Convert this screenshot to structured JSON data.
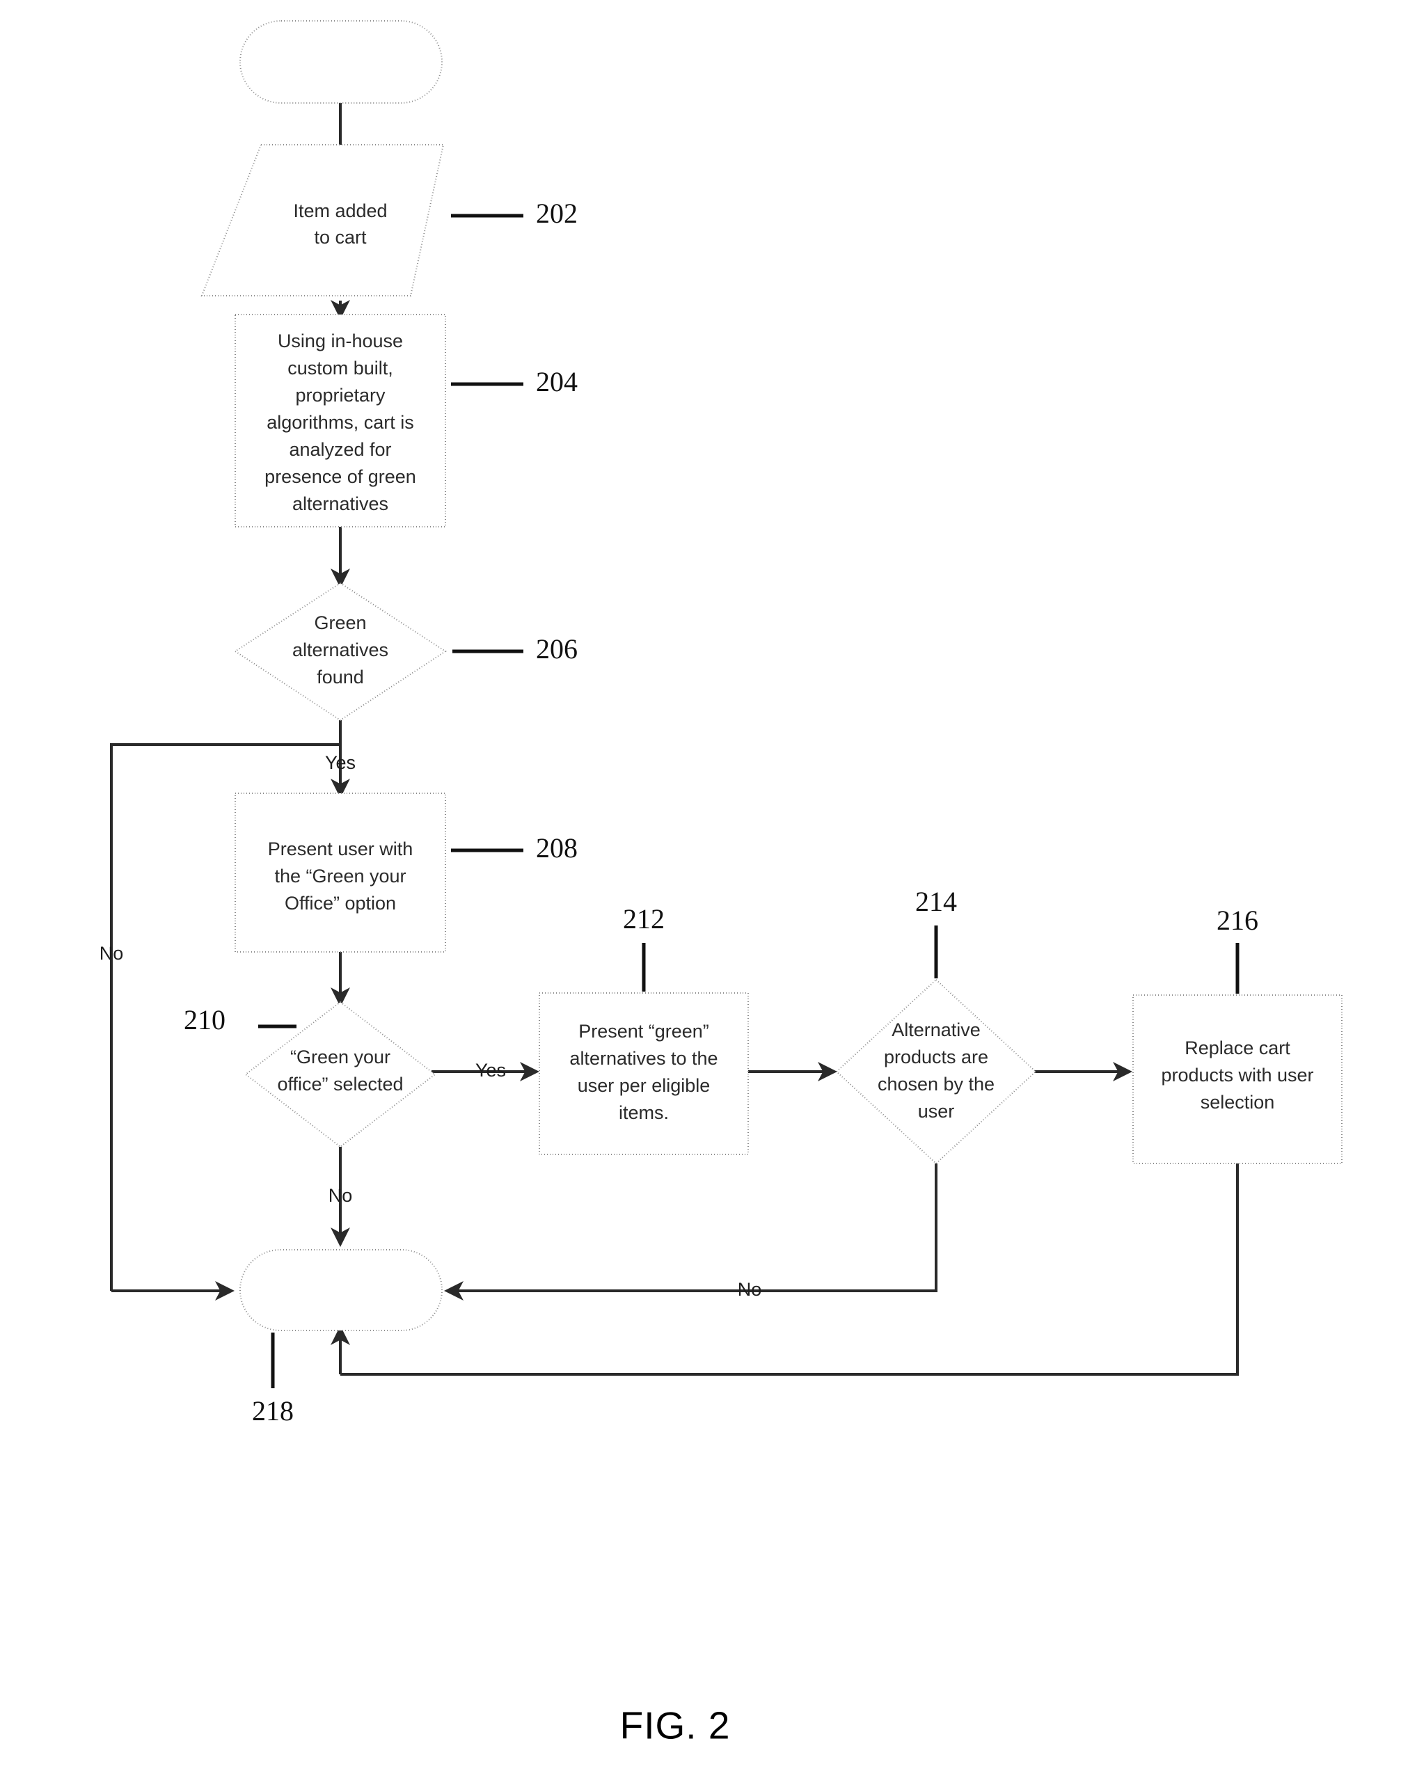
{
  "figure": {
    "caption": "FIG. 2",
    "title": "Green alternatives shopping cart flowchart"
  },
  "nodes": [
    {
      "id": "start",
      "shape": "terminator",
      "ref": "",
      "lines": []
    },
    {
      "id": "n202",
      "shape": "parallelogram",
      "ref": "202",
      "lines": [
        "Item added",
        "to cart"
      ]
    },
    {
      "id": "n204",
      "shape": "process",
      "ref": "204",
      "lines": [
        "Using in-house",
        "custom built,",
        "proprietary",
        "algorithms, cart is",
        "analyzed for",
        "presence of green",
        "alternatives"
      ]
    },
    {
      "id": "n206",
      "shape": "decision",
      "ref": "206",
      "lines": [
        "Green",
        "alternatives",
        "found"
      ]
    },
    {
      "id": "n208",
      "shape": "process",
      "ref": "208",
      "lines": [
        "Present user with",
        "the “Green your",
        "Office” option"
      ]
    },
    {
      "id": "n210",
      "shape": "decision",
      "ref": "210",
      "lines": [
        "“Green your",
        "office” selected"
      ]
    },
    {
      "id": "n212",
      "shape": "process",
      "ref": "212",
      "lines": [
        "Present “green”",
        "alternatives to the",
        "user per eligible",
        "items."
      ]
    },
    {
      "id": "n214",
      "shape": "decision",
      "ref": "214",
      "lines": [
        "Alternative",
        "products are",
        "chosen by the",
        "user"
      ]
    },
    {
      "id": "n216",
      "shape": "process",
      "ref": "216",
      "lines": [
        "Replace cart",
        "products with user",
        "selection"
      ]
    },
    {
      "id": "n218",
      "shape": "terminator",
      "ref": "218",
      "lines": []
    }
  ],
  "edge_labels": {
    "yes_206": "Yes",
    "no_206": "No",
    "yes_210": "Yes",
    "no_210": "No",
    "no_214": "No"
  },
  "colors": {
    "ink": "#1a1a1a",
    "shape_stroke": "#8a8a8a",
    "connector": "#2a2a2a",
    "background": "#ffffff"
  }
}
